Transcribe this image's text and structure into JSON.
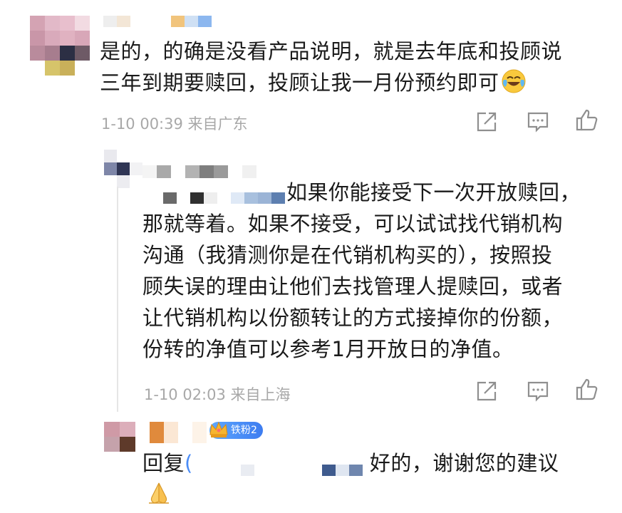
{
  "comments": [
    {
      "text_lines": [
        "是的，的确是没看产品说明，就是去年底和投顾说",
        "三年到期要赎回，投顾让我一月份预约即可"
      ],
      "emoji": "laughing-crying-emoji",
      "meta": "1-10 00:39  来自广东"
    },
    {
      "text_lines": [
        "如果你能接受下一次开放赎回，",
        "那就等着。如果不接受，可以试试找代销机构",
        "沟通（我猜测你是在代销机构买的），按照投",
        "顾失误的理由让他们去找管理人提赎回，或者",
        "让代销机构以份额转让的方式接掉你的份额，",
        "份转的净值可以参考1月开放日的净值。"
      ],
      "meta": "1-10 02:03  来自上海"
    },
    {
      "badge": "铁粉2",
      "reply_prefix": "回复",
      "reply_text": "好的，谢谢您的建议",
      "emoji": "pray-hands-emoji"
    }
  ],
  "icons": [
    "share-icon",
    "comment-icon",
    "like-icon",
    "crown-icon"
  ],
  "colors": {
    "text": "#1a1a1a",
    "meta": "#a8a8a8",
    "icon": "#8f8f8f",
    "badge": "#4a8cf7"
  }
}
